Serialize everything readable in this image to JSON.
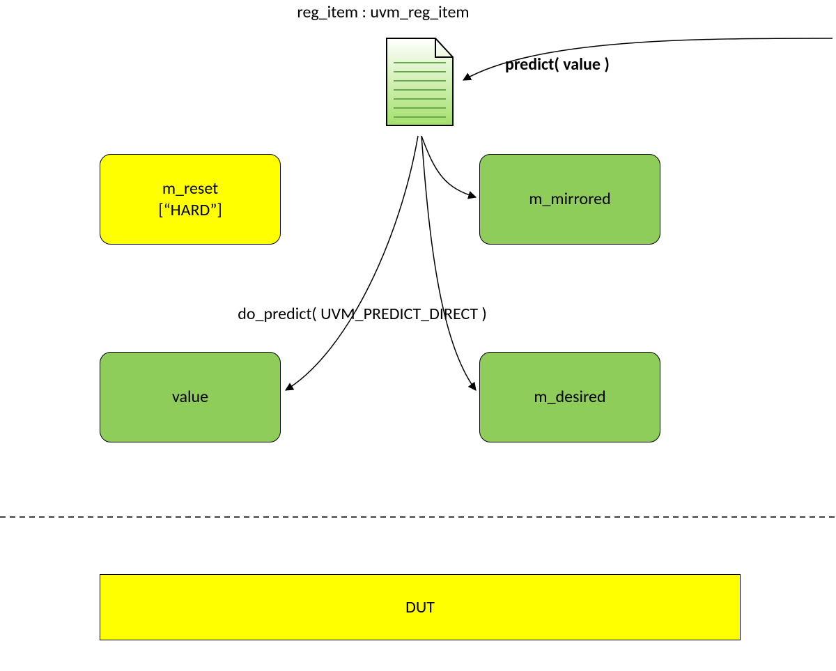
{
  "title": "reg_item : uvm_reg_item",
  "predict_label": "predict( value )",
  "do_predict_label": "do_predict( UVM_PREDICT_DIRECT )",
  "boxes": {
    "m_reset": "m_reset\n[“HARD”]",
    "m_mirrored": "m_mirrored",
    "value": "value",
    "m_desired": "m_desired"
  },
  "dut": "DUT",
  "colors": {
    "yellow": "#ffff00",
    "green": "#8ecd5a",
    "doc_fill_top": "#ffffff",
    "doc_fill_bottom": "#a4e06a"
  }
}
